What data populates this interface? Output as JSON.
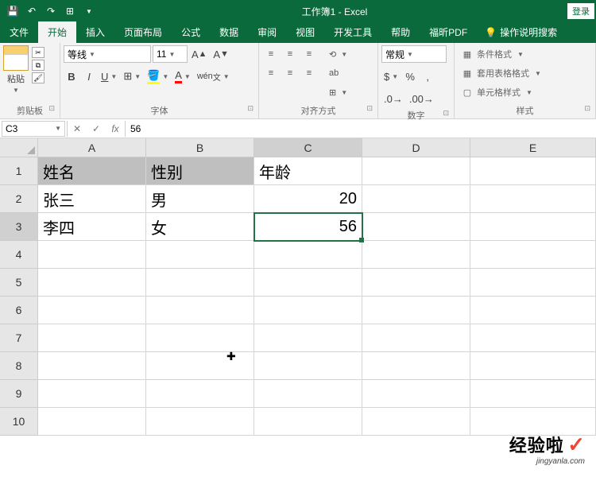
{
  "titlebar": {
    "title": "工作簿1 - Excel",
    "login": "登录"
  },
  "tabs": {
    "file": "文件",
    "home": "开始",
    "insert": "插入",
    "layout": "页面布局",
    "formulas": "公式",
    "data": "数据",
    "review": "审阅",
    "view": "视图",
    "dev": "开发工具",
    "help": "帮助",
    "foxit": "福昕PDF",
    "tellme": "操作说明搜索"
  },
  "ribbon": {
    "paste": "粘贴",
    "clipboard": "剪贴板",
    "font_name": "等线",
    "font_size": "11",
    "font_group": "字体",
    "align_group": "对齐方式",
    "number_format": "常规",
    "number_group": "数字",
    "cond_fmt": "条件格式",
    "table_fmt": "套用表格格式",
    "cell_style": "单元格样式",
    "style_group": "样式"
  },
  "fxbar": {
    "namebox": "C3",
    "value": "56"
  },
  "columns": [
    "A",
    "B",
    "C",
    "D",
    "E"
  ],
  "rows": [
    "1",
    "2",
    "3",
    "4",
    "5",
    "6",
    "7",
    "8",
    "9",
    "10"
  ],
  "cells": {
    "A1": "姓名",
    "B1": "性别",
    "C1": "年龄",
    "A2": "张三",
    "B2": "男",
    "C2": "20",
    "A3": "李四",
    "B3": "女",
    "C3": "56"
  },
  "watermark": {
    "big": "经验啦",
    "small": "jingyanla.com"
  }
}
